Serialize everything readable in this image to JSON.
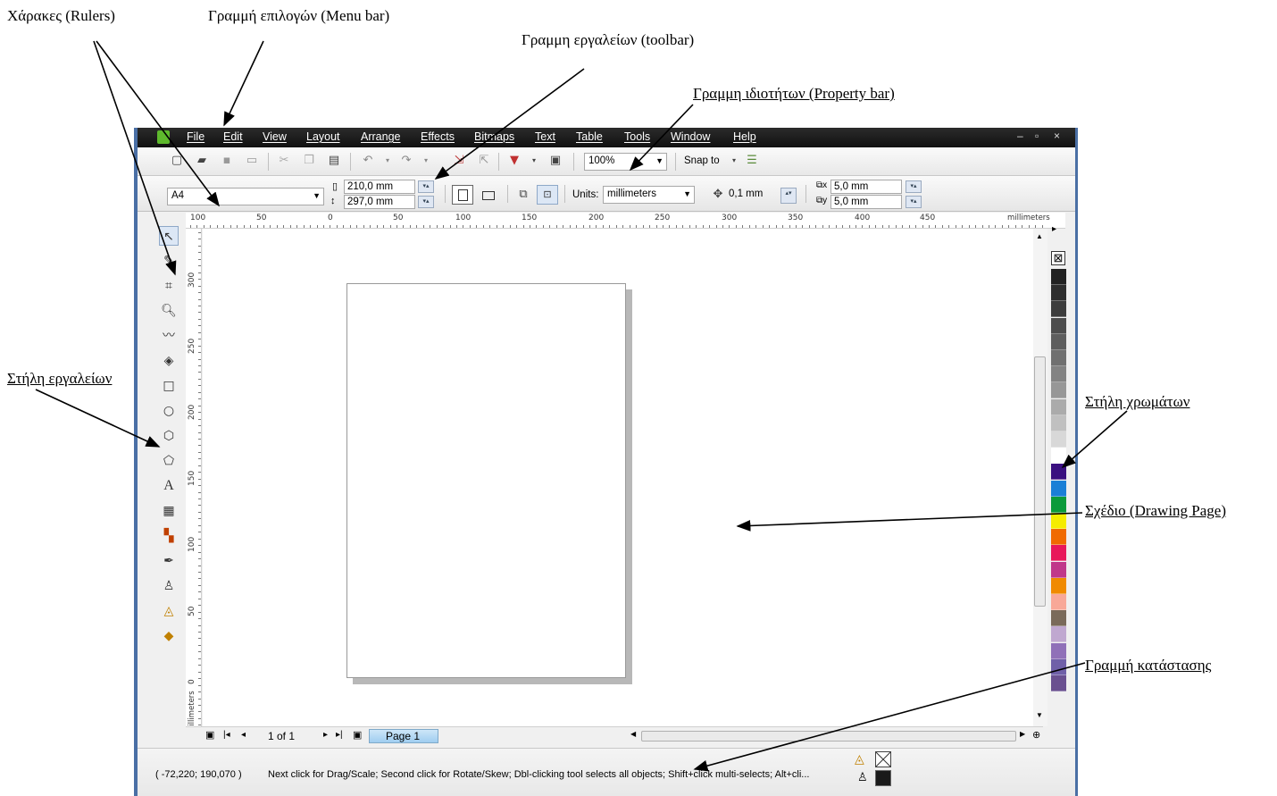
{
  "annotations": {
    "rulers": "Χάρακες (Rulers)",
    "menu_bar": "Γραμμή επιλογών (Menu bar)",
    "toolbar": "Γραμμη εργαλείων (toolbar)",
    "property_bar": "Γραμμη ιδιοτήτων (Property bar)",
    "toolbox": "Στήλη εργαλείων",
    "color_palette": "Στήλη χρωμάτων",
    "drawing_page": "Σχέδιο (Drawing Page)",
    "status_bar": "Γραμμή κατάστασης"
  },
  "menu": {
    "items": [
      "File",
      "Edit",
      "View",
      "Layout",
      "Arrange",
      "Effects",
      "Bitmaps",
      "Text",
      "Table",
      "Tools",
      "Window",
      "Help"
    ],
    "window_controls": [
      "–",
      "▫",
      "×"
    ]
  },
  "toolbar": {
    "zoom": "100%",
    "snap_to": "Snap to"
  },
  "propbar": {
    "paper_size": "A4",
    "width": "210,0 mm",
    "height": "297,0 mm",
    "units_label": "Units:",
    "units_value": "millimeters",
    "nudge": "0,1 mm",
    "dup_x": "5,0 mm",
    "dup_y": "5,0 mm"
  },
  "ruler_top": {
    "labels": [
      "100",
      "50",
      "0",
      "50",
      "100",
      "150",
      "200",
      "250",
      "300",
      "350",
      "400",
      "450"
    ],
    "unit": "millimeters"
  },
  "ruler_left": {
    "labels": [
      "300",
      "250",
      "200",
      "150",
      "100",
      "50",
      "0"
    ],
    "unit": "millimeters"
  },
  "docnav": {
    "page_count": "1 of 1",
    "page_tab": "Page 1"
  },
  "status": {
    "coords": "( -72,220; 190,070 )",
    "message": "Next click for Drag/Scale; Second click for Rotate/Skew; Dbl-clicking tool selects all objects; Shift+click multi-selects; Alt+cli..."
  },
  "palette_colors": [
    "#222222",
    "#2e2e2e",
    "#3d3d3d",
    "#4d4d4d",
    "#5e5e5e",
    "#707070",
    "#838383",
    "#979797",
    "#ababab",
    "#c0c0c0",
    "#d8d8d8",
    "#ffffff",
    "#3a1080",
    "#1a7fd6",
    "#0a9a3a",
    "#f5ec00",
    "#f06a00",
    "#e8185a",
    "#c0388a",
    "#f08a00",
    "#f8a898",
    "#7a6a5a",
    "#c0a8d0",
    "#9070b8",
    "#7060a8",
    "#6a5090"
  ]
}
